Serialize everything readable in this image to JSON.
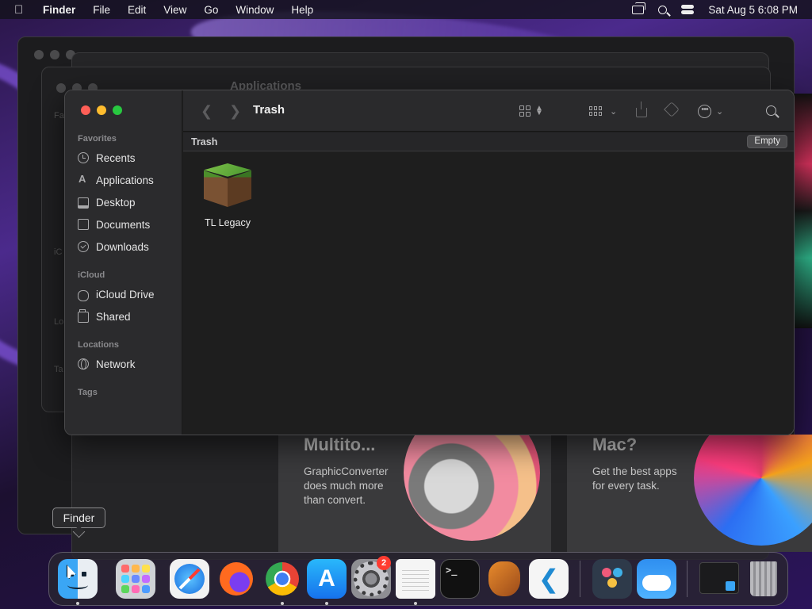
{
  "menubar": {
    "apple_icon": "apple-logo-icon",
    "app_name": "Finder",
    "menus": [
      "File",
      "Edit",
      "View",
      "Go",
      "Window",
      "Help"
    ],
    "clock": "Sat Aug 5  6:08 PM"
  },
  "background_window": {
    "title": "Applications",
    "side_labels": [
      "Fa",
      "iC",
      "Lo",
      "Ta"
    ]
  },
  "store_cards": [
    {
      "title": "Multito...",
      "text": "GraphicConverter does much more than convert."
    },
    {
      "title": "Mac?",
      "text": "Get the best apps for every task."
    }
  ],
  "finder": {
    "title": "Trash",
    "path_label": "Trash",
    "empty_button": "Empty",
    "sidebar": {
      "favorites_header": "Favorites",
      "favorites": [
        {
          "label": "Recents",
          "icon": "clock-icon"
        },
        {
          "label": "Applications",
          "icon": "applications-icon"
        },
        {
          "label": "Desktop",
          "icon": "desktop-icon"
        },
        {
          "label": "Documents",
          "icon": "document-icon"
        },
        {
          "label": "Downloads",
          "icon": "download-icon"
        }
      ],
      "icloud_header": "iCloud",
      "icloud": [
        {
          "label": "iCloud Drive",
          "icon": "cloud-icon"
        },
        {
          "label": "Shared",
          "icon": "shared-folder-icon"
        }
      ],
      "locations_header": "Locations",
      "locations": [
        {
          "label": "Network",
          "icon": "globe-icon"
        }
      ],
      "tags_header": "Tags"
    },
    "items": [
      {
        "name": "TL Legacy",
        "icon": "minecraft-grass-block-icon"
      }
    ]
  },
  "tooltip": "Finder",
  "dock": {
    "apps": [
      "Finder",
      "Launchpad",
      "Safari",
      "Firefox",
      "Google Chrome",
      "App Store",
      "System Settings",
      "TextEdit",
      "Terminal",
      "GarageBand",
      "Visual Studio Code",
      "DaVinci Resolve",
      "Weather",
      "Minimized Window",
      "Trash"
    ],
    "settings_badge": "2",
    "terminal_prompt": ">_"
  },
  "colors": {
    "traffic_close": "#ff5f57",
    "traffic_minimize": "#febc2e",
    "traffic_maximize": "#28c840",
    "badge": "#ff3b30",
    "window_bg": "#1e1e1e",
    "sidebar_bg": "#2b2b2d"
  }
}
